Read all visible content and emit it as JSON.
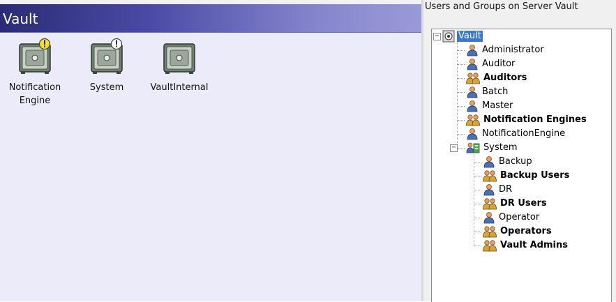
{
  "left_pane": {
    "title": "Vault",
    "items": [
      {
        "label_line1": "Notification",
        "label_line2": "Engine",
        "badge": "exclamation"
      },
      {
        "label_line1": "System",
        "label_line2": "",
        "badge": "info"
      },
      {
        "label_line1": "VaultInternal",
        "label_line2": "",
        "badge": "none"
      }
    ]
  },
  "right_pane": {
    "heading": "Users and Groups on Server Vault",
    "tree": {
      "root": {
        "label": "Vault",
        "icon": "vault-root-icon",
        "expander": "−",
        "selected": true
      },
      "children": [
        {
          "label": "Administrator",
          "type": "user"
        },
        {
          "label": "Auditor",
          "type": "user"
        },
        {
          "label": "Auditors",
          "type": "group"
        },
        {
          "label": "Batch",
          "type": "user"
        },
        {
          "label": "Master",
          "type": "user"
        },
        {
          "label": "Notification Engines",
          "type": "group"
        },
        {
          "label": "NotificationEngine",
          "type": "user"
        },
        {
          "label": "System",
          "type": "location",
          "expander": "−"
        }
      ],
      "system_children": [
        {
          "label": "Backup",
          "type": "user"
        },
        {
          "label": "Backup Users",
          "type": "group"
        },
        {
          "label": "DR",
          "type": "user"
        },
        {
          "label": "DR Users",
          "type": "group"
        },
        {
          "label": "Operator",
          "type": "user"
        },
        {
          "label": "Operators",
          "type": "group"
        },
        {
          "label": "Vault Admins",
          "type": "group"
        }
      ]
    }
  },
  "colors": {
    "title_gradient_start": "#2b2b75",
    "title_gradient_end": "#9a9ad8",
    "left_background": "#ebebf9",
    "selection": "#3a78d8",
    "user_icon_blue": "#4c6fb0",
    "user_icon_head": "#e8a060",
    "group_icon_gold": "#d7a43a"
  }
}
